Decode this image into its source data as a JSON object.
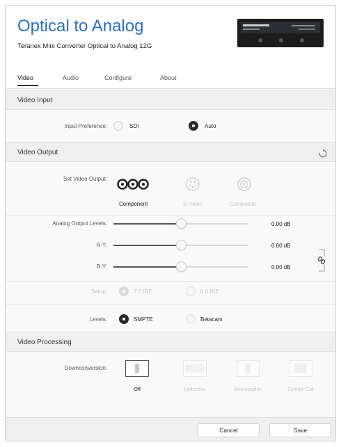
{
  "header": {
    "title": "Optical to Analog",
    "subtitle": "Teranex Mini Converter Optical to Analog 12G"
  },
  "tabs": [
    {
      "label": "Video",
      "active": true
    },
    {
      "label": "Audio",
      "active": false
    },
    {
      "label": "Configure",
      "active": false
    },
    {
      "label": "About",
      "active": false
    }
  ],
  "video_input": {
    "section_title": "Video Input",
    "input_preference_label": "Input Preference:",
    "options": [
      {
        "label": "SDI",
        "selected": false
      },
      {
        "label": "Auto",
        "selected": true
      }
    ]
  },
  "video_output": {
    "section_title": "Video Output",
    "set_output_label": "Set Video Output:",
    "outputs": [
      {
        "label": "Component",
        "selected": true
      },
      {
        "label": "S-Video",
        "selected": false
      },
      {
        "label": "Composite",
        "selected": false
      }
    ],
    "levels_label": "Analog Output Levels:",
    "sliders": [
      {
        "label": "Analog Output Levels:",
        "value": "0.00 dB",
        "position": 0.5
      },
      {
        "label": "R-Y:",
        "value": "0.00 dB",
        "position": 0.5
      },
      {
        "label": "B-Y:",
        "value": "0.00 dB",
        "position": 0.5
      }
    ],
    "setup_label": "Setup:",
    "setup_options": [
      {
        "label": "7.5 IRE",
        "selected": true
      },
      {
        "label": "0.0 IRE",
        "selected": false
      }
    ],
    "levels_row_label": "Levels:",
    "levels_options": [
      {
        "label": "SMPTE",
        "selected": true
      },
      {
        "label": "Betacam",
        "selected": false
      }
    ]
  },
  "video_processing": {
    "section_title": "Video Processing",
    "downconversion_label": "Downconversion:",
    "options": [
      {
        "label": "Off",
        "selected": true
      },
      {
        "label": "Letterbox",
        "selected": false
      },
      {
        "label": "Anamorphic",
        "selected": false
      },
      {
        "label": "Center Cut",
        "selected": false
      }
    ]
  },
  "footer": {
    "cancel_label": "Cancel",
    "save_label": "Save"
  },
  "icons": {
    "reset": "reset-icon",
    "link": "link-chain-icon"
  },
  "colors": {
    "accent": "#2b6fc2",
    "selected": "#2a2a2a",
    "section_bg": "#efefef"
  }
}
